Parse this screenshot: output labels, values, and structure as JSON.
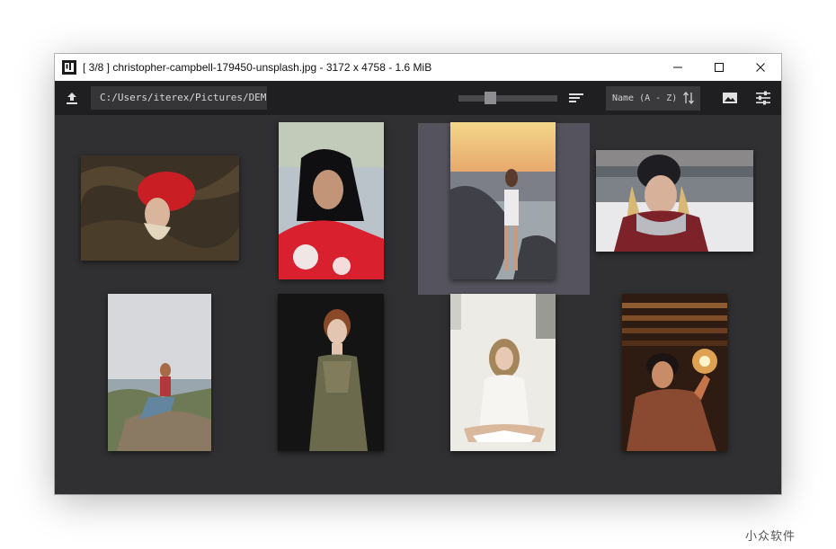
{
  "window": {
    "title": "[ 3/8 ]  christopher-campbell-179450-unsplash.jpg  -  3172 x 4758  -  1.6 MiB",
    "logo_icon": "app-logo-icon",
    "controls": {
      "minimize": "minimize-icon",
      "maximize": "maximize-icon",
      "close": "close-icon"
    }
  },
  "toolbar": {
    "upload_icon": "upload-icon",
    "path": "C:/Users/iterex/Pictures/DEMO",
    "zoom_slider_level": 0.3,
    "layout_icon": "align-left-lines-icon",
    "sort_label": "Name (A - Z)",
    "sort_icon": "sort-arrows-icon",
    "image_icon": "image-icon",
    "settings_icon": "sliders-icon"
  },
  "gallery": {
    "selected_index": 2,
    "thumbnails": [
      {
        "subject": "woman lying in dry grass, red top",
        "colors": [
          "#3b3225",
          "#c81e24"
        ]
      },
      {
        "subject": "woman with glasses, red tie-dye shirt",
        "colors": [
          "#b9c3c9",
          "#d8202e"
        ]
      },
      {
        "subject": "woman on rocks at sunset beach",
        "colors": [
          "#f0c078",
          "#3f4048"
        ]
      },
      {
        "subject": "woman in black beanie, snowy background",
        "colors": [
          "#e9e9ec",
          "#7c2228"
        ]
      },
      {
        "subject": "woman sitting on cliff by the sea",
        "colors": [
          "#d6d8dc",
          "#8a7a64"
        ]
      },
      {
        "subject": "woman in patterned dress, dark background",
        "colors": [
          "#141414",
          "#6b6a4c"
        ]
      },
      {
        "subject": "woman in white reading a book",
        "colors": [
          "#ecebe6",
          "#a5855a"
        ]
      },
      {
        "subject": "woman holding a lantern in warm light",
        "colors": [
          "#2e1c12",
          "#f2b05a"
        ]
      }
    ]
  },
  "watermark": "小众软件",
  "colors": {
    "background": "#303032",
    "toolbar": "#1f1f21",
    "selection": "#55545e",
    "titlebar": "#ffffff"
  }
}
